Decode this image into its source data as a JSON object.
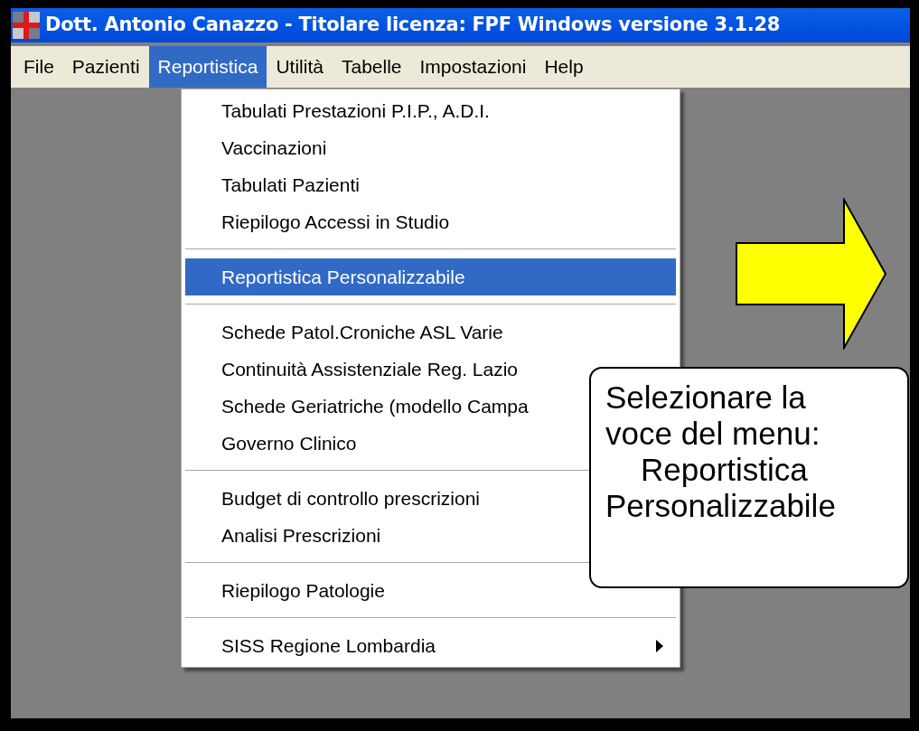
{
  "window": {
    "title": "Dott. Antonio Canazzo -  Titolare licenza: FPF Windows versione 3.1.28"
  },
  "menubar": [
    {
      "label": "File",
      "selected": false
    },
    {
      "label": "Pazienti",
      "selected": false
    },
    {
      "label": "Reportistica",
      "selected": true
    },
    {
      "label": "Utilità",
      "selected": false
    },
    {
      "label": "Tabelle",
      "selected": false
    },
    {
      "label": "Impostazioni",
      "selected": false
    },
    {
      "label": "Help",
      "selected": false
    }
  ],
  "dropdown": {
    "groups": [
      [
        {
          "label": "Tabulati Prestazioni P.I.P., A.D.I.",
          "selected": false,
          "submenu": false
        },
        {
          "label": "Vaccinazioni",
          "selected": false,
          "submenu": false
        },
        {
          "label": "Tabulati Pazienti",
          "selected": false,
          "submenu": false
        },
        {
          "label": "Riepilogo Accessi in Studio",
          "selected": false,
          "submenu": false
        }
      ],
      [
        {
          "label": "Reportistica Personalizzabile",
          "selected": true,
          "submenu": false
        }
      ],
      [
        {
          "label": "Schede Patol.Croniche ASL Varie",
          "selected": false,
          "submenu": false
        },
        {
          "label": "Continuità Assistenziale Reg. Lazio",
          "selected": false,
          "submenu": false
        },
        {
          "label": "Schede Geriatriche (modello Campa",
          "selected": false
        },
        {
          "label": "Governo Clinico",
          "selected": false
        }
      ],
      [
        {
          "label": "Budget di controllo prescrizioni",
          "selected": false
        },
        {
          "label": "Analisi Prescrizioni",
          "selected": false
        }
      ],
      [
        {
          "label": "Riepilogo Patologie",
          "selected": false,
          "submenu": false
        }
      ],
      [
        {
          "label": "SISS Regione Lombardia",
          "selected": false,
          "submenu": true
        }
      ]
    ]
  },
  "callout": {
    "lines": [
      "Selezionare la",
      "voce del menu:",
      "Reportistica",
      "Personalizzabile"
    ]
  }
}
